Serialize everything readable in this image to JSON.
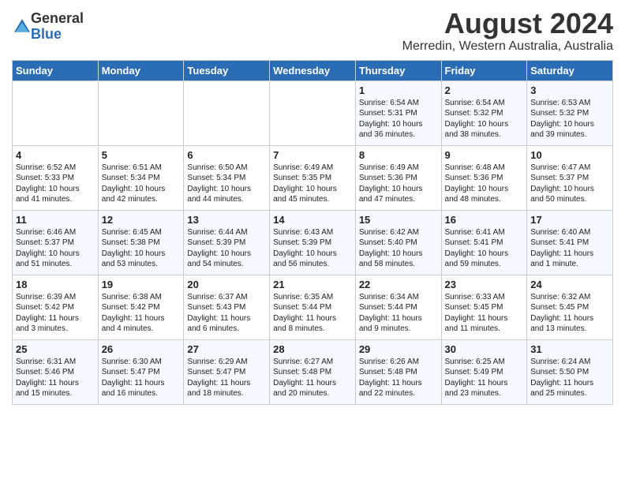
{
  "logo": {
    "general": "General",
    "blue": "Blue"
  },
  "title": "August 2024",
  "location": "Merredin, Western Australia, Australia",
  "days_of_week": [
    "Sunday",
    "Monday",
    "Tuesday",
    "Wednesday",
    "Thursday",
    "Friday",
    "Saturday"
  ],
  "weeks": [
    [
      {
        "day": "",
        "info": ""
      },
      {
        "day": "",
        "info": ""
      },
      {
        "day": "",
        "info": ""
      },
      {
        "day": "",
        "info": ""
      },
      {
        "day": "1",
        "info": "Sunrise: 6:54 AM\nSunset: 5:31 PM\nDaylight: 10 hours\nand 36 minutes."
      },
      {
        "day": "2",
        "info": "Sunrise: 6:54 AM\nSunset: 5:32 PM\nDaylight: 10 hours\nand 38 minutes."
      },
      {
        "day": "3",
        "info": "Sunrise: 6:53 AM\nSunset: 5:32 PM\nDaylight: 10 hours\nand 39 minutes."
      }
    ],
    [
      {
        "day": "4",
        "info": "Sunrise: 6:52 AM\nSunset: 5:33 PM\nDaylight: 10 hours\nand 41 minutes."
      },
      {
        "day": "5",
        "info": "Sunrise: 6:51 AM\nSunset: 5:34 PM\nDaylight: 10 hours\nand 42 minutes."
      },
      {
        "day": "6",
        "info": "Sunrise: 6:50 AM\nSunset: 5:34 PM\nDaylight: 10 hours\nand 44 minutes."
      },
      {
        "day": "7",
        "info": "Sunrise: 6:49 AM\nSunset: 5:35 PM\nDaylight: 10 hours\nand 45 minutes."
      },
      {
        "day": "8",
        "info": "Sunrise: 6:49 AM\nSunset: 5:36 PM\nDaylight: 10 hours\nand 47 minutes."
      },
      {
        "day": "9",
        "info": "Sunrise: 6:48 AM\nSunset: 5:36 PM\nDaylight: 10 hours\nand 48 minutes."
      },
      {
        "day": "10",
        "info": "Sunrise: 6:47 AM\nSunset: 5:37 PM\nDaylight: 10 hours\nand 50 minutes."
      }
    ],
    [
      {
        "day": "11",
        "info": "Sunrise: 6:46 AM\nSunset: 5:37 PM\nDaylight: 10 hours\nand 51 minutes."
      },
      {
        "day": "12",
        "info": "Sunrise: 6:45 AM\nSunset: 5:38 PM\nDaylight: 10 hours\nand 53 minutes."
      },
      {
        "day": "13",
        "info": "Sunrise: 6:44 AM\nSunset: 5:39 PM\nDaylight: 10 hours\nand 54 minutes."
      },
      {
        "day": "14",
        "info": "Sunrise: 6:43 AM\nSunset: 5:39 PM\nDaylight: 10 hours\nand 56 minutes."
      },
      {
        "day": "15",
        "info": "Sunrise: 6:42 AM\nSunset: 5:40 PM\nDaylight: 10 hours\nand 58 minutes."
      },
      {
        "day": "16",
        "info": "Sunrise: 6:41 AM\nSunset: 5:41 PM\nDaylight: 10 hours\nand 59 minutes."
      },
      {
        "day": "17",
        "info": "Sunrise: 6:40 AM\nSunset: 5:41 PM\nDaylight: 11 hours\nand 1 minute."
      }
    ],
    [
      {
        "day": "18",
        "info": "Sunrise: 6:39 AM\nSunset: 5:42 PM\nDaylight: 11 hours\nand 3 minutes."
      },
      {
        "day": "19",
        "info": "Sunrise: 6:38 AM\nSunset: 5:42 PM\nDaylight: 11 hours\nand 4 minutes."
      },
      {
        "day": "20",
        "info": "Sunrise: 6:37 AM\nSunset: 5:43 PM\nDaylight: 11 hours\nand 6 minutes."
      },
      {
        "day": "21",
        "info": "Sunrise: 6:35 AM\nSunset: 5:44 PM\nDaylight: 11 hours\nand 8 minutes."
      },
      {
        "day": "22",
        "info": "Sunrise: 6:34 AM\nSunset: 5:44 PM\nDaylight: 11 hours\nand 9 minutes."
      },
      {
        "day": "23",
        "info": "Sunrise: 6:33 AM\nSunset: 5:45 PM\nDaylight: 11 hours\nand 11 minutes."
      },
      {
        "day": "24",
        "info": "Sunrise: 6:32 AM\nSunset: 5:45 PM\nDaylight: 11 hours\nand 13 minutes."
      }
    ],
    [
      {
        "day": "25",
        "info": "Sunrise: 6:31 AM\nSunset: 5:46 PM\nDaylight: 11 hours\nand 15 minutes."
      },
      {
        "day": "26",
        "info": "Sunrise: 6:30 AM\nSunset: 5:47 PM\nDaylight: 11 hours\nand 16 minutes."
      },
      {
        "day": "27",
        "info": "Sunrise: 6:29 AM\nSunset: 5:47 PM\nDaylight: 11 hours\nand 18 minutes."
      },
      {
        "day": "28",
        "info": "Sunrise: 6:27 AM\nSunset: 5:48 PM\nDaylight: 11 hours\nand 20 minutes."
      },
      {
        "day": "29",
        "info": "Sunrise: 6:26 AM\nSunset: 5:48 PM\nDaylight: 11 hours\nand 22 minutes."
      },
      {
        "day": "30",
        "info": "Sunrise: 6:25 AM\nSunset: 5:49 PM\nDaylight: 11 hours\nand 23 minutes."
      },
      {
        "day": "31",
        "info": "Sunrise: 6:24 AM\nSunset: 5:50 PM\nDaylight: 11 hours\nand 25 minutes."
      }
    ]
  ]
}
